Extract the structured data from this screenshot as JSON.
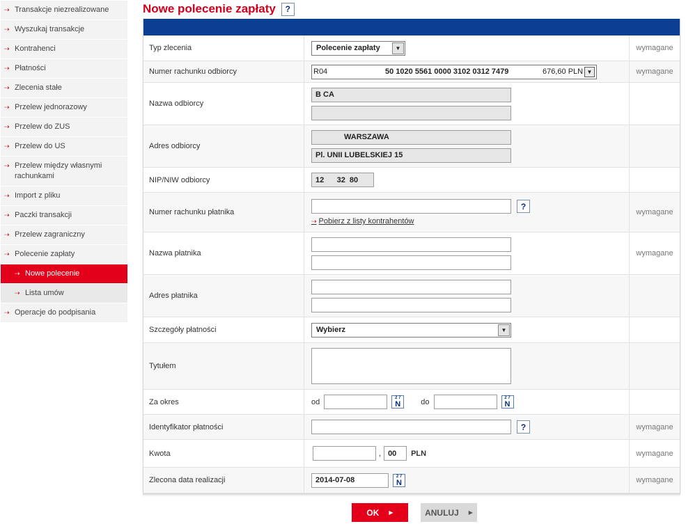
{
  "sidebar": {
    "items": [
      {
        "label": "Transakcje niezrealizowane"
      },
      {
        "label": "Wyszukaj transakcje"
      },
      {
        "label": "Kontrahenci"
      },
      {
        "label": "Płatności"
      },
      {
        "label": "Zlecenia stałe"
      },
      {
        "label": "Przelew jednorazowy"
      },
      {
        "label": "Przelew do ZUS"
      },
      {
        "label": "Przelew do US"
      },
      {
        "label": "Przelew między własnymi rachunkami"
      },
      {
        "label": "Import z pliku"
      },
      {
        "label": "Paczki transakcji"
      },
      {
        "label": "Przelew zagraniczny"
      },
      {
        "label": "Polecenie zapłaty"
      },
      {
        "label": "Nowe polecenie"
      },
      {
        "label": "Lista umów"
      },
      {
        "label": "Operacje do podpisania"
      }
    ]
  },
  "header": {
    "title": "Nowe polecenie zapłaty",
    "help": "?"
  },
  "form": {
    "required_text": "wymagane",
    "order_type": {
      "label": "Typ zlecenia",
      "value": "Polecenie zapłaty"
    },
    "recipient_account": {
      "label": "Numer rachunku odbiorcy",
      "code": "R04",
      "number": "50 1020 5561 0000 3102 0312 7479",
      "balance": "676,60 PLN"
    },
    "recipient_name": {
      "label": "Nazwa odbiorcy",
      "line1": "B      CA",
      "line2": ""
    },
    "recipient_address": {
      "label": "Adres odbiorcy",
      "line1": "WARSZAWA",
      "line2": "Pl. UNII LUBELSKIEJ 15"
    },
    "recipient_nip": {
      "label": "NIP/NIW odbiorcy",
      "value": "12      32  80"
    },
    "payer_account": {
      "label": "Numer rachunku płatnika",
      "value": "",
      "help": "?",
      "link": "Pobierz z listy kontrahentów"
    },
    "payer_name": {
      "label": "Nazwa płatnika",
      "line1": "",
      "line2": ""
    },
    "payer_address": {
      "label": "Adres płatnika",
      "line1": "",
      "line2": ""
    },
    "payment_details": {
      "label": "Szczegóły płatności",
      "value": "Wybierz"
    },
    "title_field": {
      "label": "Tytułem",
      "value": ""
    },
    "period": {
      "label": "Za okres",
      "from_label": "od",
      "to_label": "do",
      "from": "",
      "to": ""
    },
    "payment_id": {
      "label": "Identyfikator płatności",
      "value": "",
      "help": "?"
    },
    "amount": {
      "label": "Kwota",
      "whole": "",
      "separator": ",",
      "fraction": "00",
      "currency": "PLN"
    },
    "exec_date": {
      "label": "Zlecona data realizacji",
      "value": "2014-07-08"
    },
    "calendar": {
      "top": "2 7",
      "letter": "N"
    }
  },
  "buttons": {
    "ok": "OK",
    "cancel": "ANULUJ"
  }
}
